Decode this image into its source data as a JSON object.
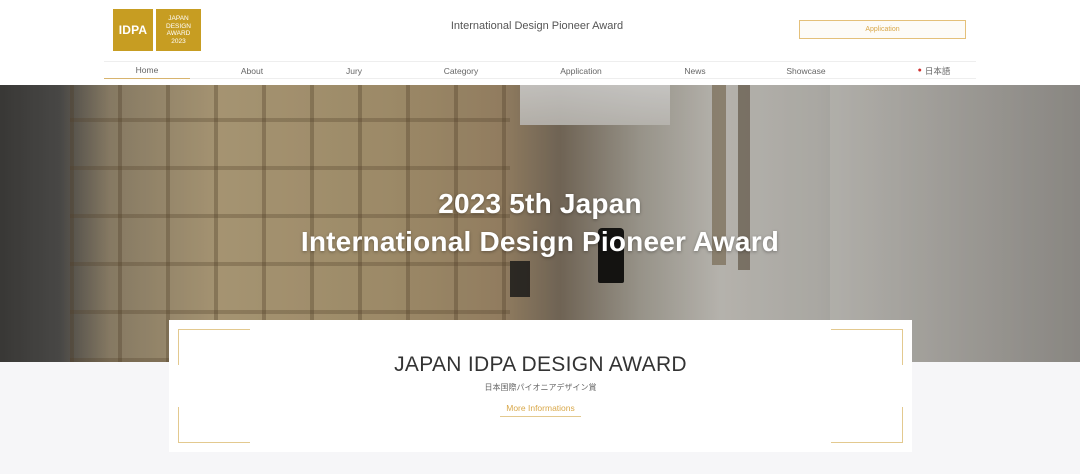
{
  "header": {
    "logo": {
      "left_text": "IDPA",
      "right_lines": [
        "JAPAN",
        "DESIGN",
        "AWARD",
        "2023"
      ]
    },
    "site_title": "International Design Pioneer Award",
    "application_button": "Application"
  },
  "nav": {
    "items": [
      {
        "label": "Home",
        "active": true
      },
      {
        "label": "About",
        "active": false
      },
      {
        "label": "Jury",
        "active": false
      },
      {
        "label": "Category",
        "active": false
      },
      {
        "label": "Application",
        "active": false
      },
      {
        "label": "News",
        "active": false
      },
      {
        "label": "Showcase",
        "active": false
      }
    ],
    "language": "日本語"
  },
  "hero": {
    "line1": "2023 5th Japan",
    "line2": "International Design Pioneer Award"
  },
  "award": {
    "title": "JAPAN IDPA DESIGN AWARD",
    "subtitle": "日本国際パイオニアデザイン賞",
    "more_link": "More Informations"
  },
  "colors": {
    "brand_gold": "#c79d22",
    "accent_gold": "#d9a84a",
    "hero_text": "#ffffff"
  }
}
